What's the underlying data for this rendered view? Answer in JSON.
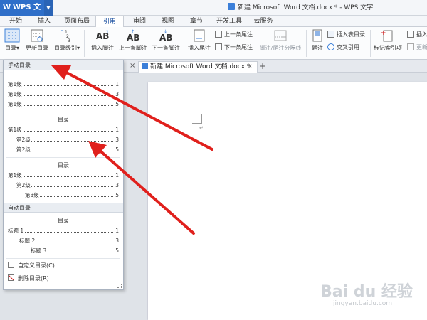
{
  "app": {
    "logo_label": "WPS 文字",
    "doc_title": "新建 Microsoft Word 文档.docx * - WPS 文字"
  },
  "menu": {
    "tabs": [
      "开始",
      "插入",
      "页面布局",
      "引用",
      "审阅",
      "视图",
      "章节",
      "开发工具",
      "云服务"
    ]
  },
  "ribbon": {
    "toc": "目录",
    "update_toc": "更新目录",
    "toc_level": "目录级别",
    "insert_footnote": "插入脚注",
    "prev_footnote": "上一条脚注",
    "next_footnote": "下一条脚注",
    "insert_endnote": "插入尾注",
    "prev_endnote": "上一条尾注",
    "next_endnote": "下一条尾注",
    "footnote_sep": "脚注/尾注分隔线",
    "caption": "题注",
    "insert_table_of_figures": "插入表目录",
    "cross_reference": "交叉引用",
    "mark_entry": "标记索引项",
    "insert_index": "插入",
    "update_index": "更新"
  },
  "doctab": {
    "label": "新建 Microsoft Word 文档.docx *"
  },
  "dropdown": {
    "manual_header": "手动目录",
    "auto_header": "自动目录",
    "toc_heading": "目录",
    "block1": [
      {
        "label": "第1级",
        "page": "1"
      },
      {
        "label": "第1级",
        "page": "3"
      },
      {
        "label": "第1级",
        "page": "5"
      }
    ],
    "block2": [
      {
        "label": "第1级",
        "page": "1"
      },
      {
        "label": "第2级",
        "page": "3"
      },
      {
        "label": "第2级",
        "page": "5"
      }
    ],
    "block3": [
      {
        "label": "第1级",
        "page": "1"
      },
      {
        "label": "第2级",
        "page": "3"
      },
      {
        "label": "第3级",
        "page": "5"
      }
    ],
    "block4": [
      {
        "label": "标题 1",
        "page": "1"
      },
      {
        "label": "标题 2",
        "page": "3"
      },
      {
        "label": "标题 3",
        "page": "5"
      }
    ],
    "custom_toc": "自定义目录(C)...",
    "delete_toc": "删除目录(R)"
  },
  "watermark": {
    "main": "Bai du 经验",
    "sub": "jingyan.baidu.com"
  },
  "colors": {
    "accent_blue": "#2f6fc9",
    "arrow_red": "#e0201c",
    "toc_dotline": "#555555"
  }
}
